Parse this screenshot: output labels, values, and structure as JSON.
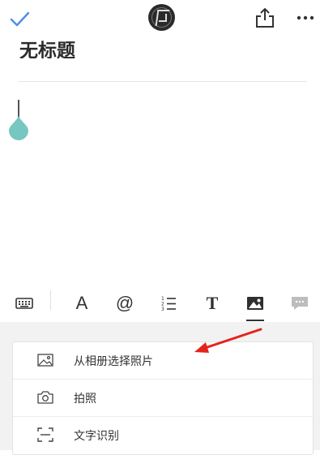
{
  "document": {
    "title": "无标题"
  },
  "colors": {
    "accent": "#4a90e2",
    "cursor_handle": "#76c7c0",
    "annotation_arrow": "#e5231b"
  },
  "icons": {
    "check": "check-icon",
    "avatar": "avatar-logo",
    "share": "share-icon",
    "more": "more-icon",
    "keyboard": "keyboard-icon",
    "font": "font-icon",
    "mention": "at-icon",
    "ordered_list": "ordered-list-icon",
    "text_style": "text-style-icon",
    "image": "image-icon",
    "comment": "comment-icon"
  },
  "toolbar": {
    "font_glyph": "A",
    "mention_glyph": "@",
    "text_style_glyph": "T",
    "active": "image"
  },
  "image_menu": {
    "items": [
      {
        "label": "从相册选择照片",
        "icon": "album-icon"
      },
      {
        "label": "拍照",
        "icon": "camera-icon"
      },
      {
        "label": "文字识别",
        "icon": "scan-icon"
      }
    ]
  }
}
